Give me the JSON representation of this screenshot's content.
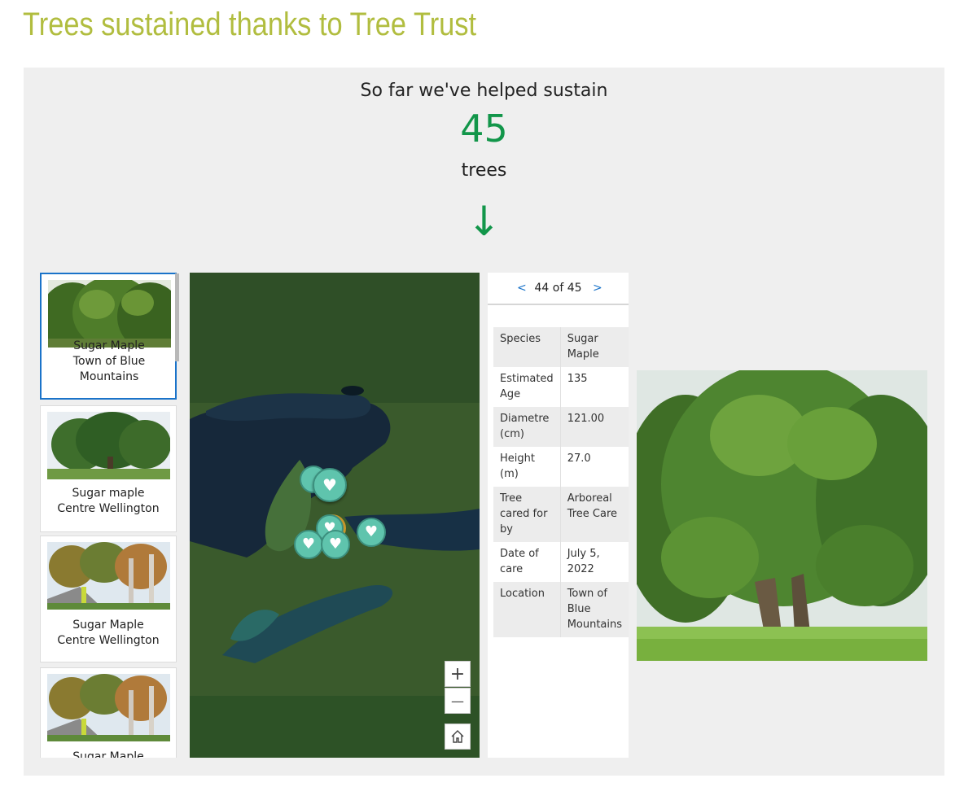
{
  "page": {
    "title": "Trees sustained thanks to Tree Trust"
  },
  "intro": {
    "line1": "So far we've helped sustain",
    "count": "45",
    "unit": "trees",
    "arrow": "↓"
  },
  "gallery": {
    "items": [
      {
        "species": "Sugar Maple",
        "location": "Town of Blue Mountains",
        "selected": true
      },
      {
        "species": "Sugar maple",
        "location": "Centre Wellington"
      },
      {
        "species": "Sugar Maple",
        "location": "Centre Wellington"
      },
      {
        "species": "Sugar Maple",
        "location": ""
      }
    ]
  },
  "map": {
    "zoom_in": "+",
    "zoom_out": "—",
    "home_icon": "home-icon",
    "marker_icon": "heart-leaf-icon",
    "marker_color": "#5fc4ad"
  },
  "details": {
    "pager": {
      "prev": "<",
      "position": "44 of 45",
      "next": ">"
    },
    "attributes": [
      {
        "key": "Species",
        "value": "Sugar Maple"
      },
      {
        "key": "Estimated Age",
        "value": "135"
      },
      {
        "key": "Diametre (cm)",
        "value": "121.00"
      },
      {
        "key": "Height (m)",
        "value": "27.0"
      },
      {
        "key": "Tree cared for by",
        "value": "Arboreal Tree Care"
      },
      {
        "key": "Date of care",
        "value": "July 5, 2022"
      },
      {
        "key": "Location",
        "value": "Town of Blue Mountains"
      }
    ]
  },
  "colors": {
    "title": "#b1bd3f",
    "accent": "#12964a",
    "selection": "#1a73c9",
    "panel": "#efefef"
  }
}
